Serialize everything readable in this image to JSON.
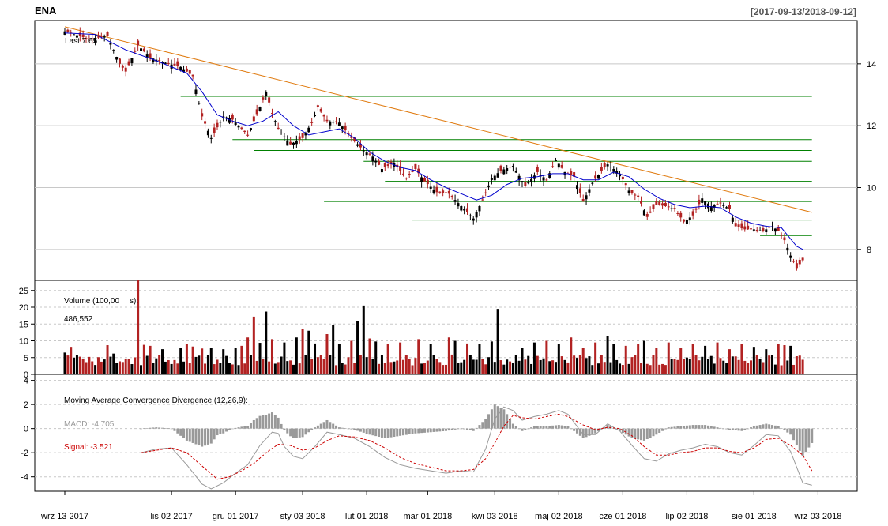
{
  "header": {
    "ticker": "ENA",
    "date_range": "[2017-09-13/2018-09-12]"
  },
  "colors": {
    "up": "#000000",
    "down": "#b22222",
    "sma": "#0000cc",
    "trend": "#e07b10",
    "support": "#008000",
    "macd_hist": "#999999",
    "signal": "#cc0000",
    "macd_line": "#999999"
  },
  "chart_data": [
    {
      "type": "candlestick",
      "panel": "price",
      "last_label": "Last 7.65",
      "x_tick_labels": [
        "wrz 13 2017",
        "lis 02 2017",
        "gru 01 2017",
        "sty 03 2018",
        "lut 01 2018",
        "mar 01 2018",
        "kwi 03 2018",
        "maj 02 2018",
        "cze 01 2018",
        "lip 02 2018",
        "sie 01 2018",
        "wrz 03 2018"
      ],
      "x_tick_index": [
        0,
        35,
        56,
        78,
        99,
        119,
        141,
        162,
        183,
        204,
        226,
        247
      ],
      "n_sessions": 253,
      "y_ticks": [
        8,
        10,
        12,
        14
      ],
      "ylim": [
        7.0,
        15.4
      ],
      "close_path": [
        [
          0,
          15.05
        ],
        [
          8,
          14.8
        ],
        [
          14,
          14.9
        ],
        [
          18,
          14.0
        ],
        [
          20,
          13.75
        ],
        [
          24,
          14.6
        ],
        [
          28,
          14.2
        ],
        [
          34,
          14.0
        ],
        [
          38,
          13.9
        ],
        [
          42,
          13.6
        ],
        [
          45,
          12.3
        ],
        [
          48,
          11.6
        ],
        [
          52,
          12.3
        ],
        [
          55,
          12.2
        ],
        [
          58,
          11.9
        ],
        [
          60,
          11.7
        ],
        [
          64,
          12.6
        ],
        [
          66,
          13.1
        ],
        [
          68,
          12.4
        ],
        [
          70,
          11.9
        ],
        [
          74,
          11.4
        ],
        [
          78,
          11.6
        ],
        [
          81,
          12.1
        ],
        [
          83,
          12.6
        ],
        [
          86,
          12.15
        ],
        [
          90,
          12.1
        ],
        [
          94,
          11.6
        ],
        [
          98,
          11.2
        ],
        [
          101,
          11.0
        ],
        [
          104,
          10.6
        ],
        [
          108,
          10.8
        ],
        [
          112,
          10.3
        ],
        [
          115,
          10.6
        ],
        [
          118,
          10.2
        ],
        [
          122,
          9.85
        ],
        [
          126,
          9.8
        ],
        [
          130,
          9.4
        ],
        [
          134,
          9.0
        ],
        [
          137,
          9.6
        ],
        [
          140,
          10.3
        ],
        [
          143,
          10.55
        ],
        [
          147,
          10.7
        ],
        [
          151,
          10.05
        ],
        [
          155,
          10.5
        ],
        [
          158,
          10.25
        ],
        [
          161,
          10.9
        ],
        [
          164,
          10.5
        ],
        [
          167,
          10.35
        ],
        [
          170,
          9.55
        ],
        [
          173,
          10.15
        ],
        [
          176,
          10.55
        ],
        [
          178,
          10.75
        ],
        [
          182,
          10.45
        ],
        [
          185,
          9.9
        ],
        [
          188,
          9.7
        ],
        [
          191,
          9.05
        ],
        [
          194,
          9.45
        ],
        [
          197,
          9.4
        ],
        [
          200,
          9.3
        ],
        [
          203,
          8.9
        ],
        [
          206,
          9.1
        ],
        [
          209,
          9.65
        ],
        [
          212,
          9.4
        ],
        [
          215,
          9.5
        ],
        [
          218,
          9.3
        ],
        [
          220,
          8.75
        ],
        [
          223,
          8.65
        ],
        [
          226,
          8.65
        ],
        [
          229,
          8.6
        ],
        [
          232,
          8.75
        ],
        [
          234,
          8.6
        ],
        [
          236,
          8.3
        ],
        [
          238,
          7.8
        ],
        [
          240,
          7.4
        ],
        [
          242,
          7.65
        ]
      ],
      "sma_path": [
        [
          0,
          15.0
        ],
        [
          10,
          14.95
        ],
        [
          20,
          14.45
        ],
        [
          30,
          14.1
        ],
        [
          40,
          13.7
        ],
        [
          45,
          13.1
        ],
        [
          50,
          12.35
        ],
        [
          55,
          12.15
        ],
        [
          60,
          12.0
        ],
        [
          65,
          12.15
        ],
        [
          70,
          12.45
        ],
        [
          75,
          12.0
        ],
        [
          80,
          11.7
        ],
        [
          85,
          11.8
        ],
        [
          90,
          11.9
        ],
        [
          95,
          11.6
        ],
        [
          100,
          11.15
        ],
        [
          105,
          10.85
        ],
        [
          110,
          10.65
        ],
        [
          115,
          10.55
        ],
        [
          120,
          10.25
        ],
        [
          125,
          10.0
        ],
        [
          130,
          9.8
        ],
        [
          135,
          9.6
        ],
        [
          140,
          9.75
        ],
        [
          145,
          10.1
        ],
        [
          150,
          10.3
        ],
        [
          155,
          10.35
        ],
        [
          160,
          10.45
        ],
        [
          165,
          10.45
        ],
        [
          170,
          10.25
        ],
        [
          175,
          10.25
        ],
        [
          180,
          10.5
        ],
        [
          185,
          10.35
        ],
        [
          190,
          9.95
        ],
        [
          195,
          9.65
        ],
        [
          200,
          9.45
        ],
        [
          205,
          9.35
        ],
        [
          210,
          9.4
        ],
        [
          215,
          9.35
        ],
        [
          220,
          9.05
        ],
        [
          225,
          8.85
        ],
        [
          230,
          8.75
        ],
        [
          235,
          8.7
        ],
        [
          240,
          8.1
        ],
        [
          242,
          8.0
        ]
      ],
      "trend_line": [
        [
          0,
          15.2
        ],
        [
          245,
          9.2
        ]
      ],
      "support_lines": [
        {
          "y": 12.95,
          "from": 38,
          "to": 245
        },
        {
          "y": 11.55,
          "from": 55,
          "to": 245
        },
        {
          "y": 11.2,
          "from": 62,
          "to": 245
        },
        {
          "y": 10.85,
          "from": 98,
          "to": 245
        },
        {
          "y": 10.2,
          "from": 105,
          "to": 245
        },
        {
          "y": 9.55,
          "from": 85,
          "to": 245
        },
        {
          "y": 8.95,
          "from": 114,
          "to": 245
        },
        {
          "y": 8.45,
          "from": 228,
          "to": 245
        }
      ]
    },
    {
      "type": "bar",
      "panel": "volume",
      "label": "Volume (100,00",
      "label_hidden_tail": "s):",
      "value_label": "486,552",
      "y_ticks": [
        0,
        5,
        10,
        15,
        20,
        25
      ],
      "ylim": [
        0,
        28
      ],
      "baseline": 4.3,
      "spikes": [
        [
          0,
          6.5
        ],
        [
          2,
          8.2
        ],
        [
          14,
          8.7
        ],
        [
          16,
          6.2
        ],
        [
          24,
          28
        ],
        [
          26,
          8.8
        ],
        [
          28,
          8.5
        ],
        [
          32,
          7.5
        ],
        [
          38,
          8.0
        ],
        [
          40,
          9.0
        ],
        [
          42,
          8.3
        ],
        [
          45,
          7.7
        ],
        [
          48,
          7.8
        ],
        [
          52,
          7.5
        ],
        [
          56,
          8.0
        ],
        [
          58,
          8.5
        ],
        [
          60,
          11.0
        ],
        [
          62,
          17.2
        ],
        [
          64,
          9.4
        ],
        [
          66,
          18.7
        ],
        [
          68,
          10.5
        ],
        [
          72,
          9.5
        ],
        [
          76,
          11.0
        ],
        [
          78,
          13.5
        ],
        [
          80,
          13.0
        ],
        [
          82,
          9.2
        ],
        [
          86,
          12.0
        ],
        [
          88,
          14.8
        ],
        [
          90,
          9.0
        ],
        [
          94,
          10.0
        ],
        [
          96,
          16.0
        ],
        [
          98,
          20.5
        ],
        [
          100,
          10.7
        ],
        [
          102,
          9.8
        ],
        [
          106,
          9.0
        ],
        [
          110,
          9.5
        ],
        [
          116,
          10.5
        ],
        [
          120,
          9.0
        ],
        [
          126,
          11.0
        ],
        [
          128,
          10.0
        ],
        [
          132,
          9.2
        ],
        [
          136,
          9.0
        ],
        [
          140,
          9.8
        ],
        [
          142,
          19.5
        ],
        [
          150,
          8.0
        ],
        [
          154,
          9.5
        ],
        [
          158,
          10.0
        ],
        [
          162,
          9.0
        ],
        [
          166,
          11.0
        ],
        [
          170,
          8.0
        ],
        [
          174,
          9.5
        ],
        [
          178,
          11.5
        ],
        [
          180,
          9.0
        ],
        [
          184,
          8.5
        ],
        [
          188,
          9.0
        ],
        [
          190,
          10.0
        ],
        [
          194,
          8.0
        ],
        [
          198,
          9.5
        ],
        [
          202,
          8.0
        ],
        [
          206,
          9.0
        ],
        [
          210,
          8.5
        ],
        [
          214,
          9.5
        ],
        [
          218,
          7.5
        ],
        [
          222,
          9.0
        ],
        [
          226,
          8.2
        ],
        [
          230,
          7.5
        ],
        [
          234,
          9.0
        ],
        [
          236,
          8.7
        ],
        [
          238,
          8.5
        ]
      ]
    },
    {
      "type": "macd",
      "panel": "macd",
      "title": "Moving Average Convergence Divergence (12,26,9):",
      "macd_label": "MACD: -4.705",
      "signal_label": "Signal: -3.521",
      "y_ticks": [
        -4,
        -2,
        0,
        2,
        4
      ],
      "ylim": [
        -5.2,
        4.5
      ],
      "macd_path": [
        [
          25,
          -2.0
        ],
        [
          30,
          -1.7
        ],
        [
          35,
          -1.6
        ],
        [
          40,
          -3.0
        ],
        [
          45,
          -4.6
        ],
        [
          48,
          -5.0
        ],
        [
          52,
          -4.5
        ],
        [
          56,
          -3.7
        ],
        [
          60,
          -3.0
        ],
        [
          64,
          -1.4
        ],
        [
          68,
          -0.3
        ],
        [
          70,
          -0.4
        ],
        [
          72,
          -1.5
        ],
        [
          75,
          -2.3
        ],
        [
          78,
          -2.5
        ],
        [
          82,
          -1.5
        ],
        [
          86,
          -0.3
        ],
        [
          90,
          -0.5
        ],
        [
          95,
          -0.8
        ],
        [
          100,
          -1.5
        ],
        [
          105,
          -2.4
        ],
        [
          110,
          -3.0
        ],
        [
          115,
          -3.3
        ],
        [
          120,
          -3.5
        ],
        [
          125,
          -3.7
        ],
        [
          130,
          -3.5
        ],
        [
          134,
          -3.6
        ],
        [
          138,
          -1.7
        ],
        [
          141,
          0.8
        ],
        [
          144,
          1.8
        ],
        [
          147,
          1.5
        ],
        [
          150,
          0.7
        ],
        [
          154,
          1.0
        ],
        [
          158,
          1.2
        ],
        [
          162,
          1.5
        ],
        [
          165,
          1.2
        ],
        [
          170,
          -0.5
        ],
        [
          174,
          -0.5
        ],
        [
          178,
          0.4
        ],
        [
          182,
          -0.2
        ],
        [
          186,
          -1.4
        ],
        [
          190,
          -2.5
        ],
        [
          194,
          -2.7
        ],
        [
          198,
          -2.1
        ],
        [
          202,
          -1.8
        ],
        [
          206,
          -1.6
        ],
        [
          210,
          -1.3
        ],
        [
          214,
          -1.5
        ],
        [
          218,
          -2.0
        ],
        [
          222,
          -2.2
        ],
        [
          226,
          -1.4
        ],
        [
          230,
          -0.5
        ],
        [
          234,
          -0.6
        ],
        [
          238,
          -1.9
        ],
        [
          242,
          -4.5
        ],
        [
          245,
          -4.7
        ]
      ],
      "signal_path": [
        [
          25,
          -2.0
        ],
        [
          30,
          -1.8
        ],
        [
          35,
          -1.6
        ],
        [
          40,
          -2.0
        ],
        [
          45,
          -3.1
        ],
        [
          50,
          -4.2
        ],
        [
          54,
          -4.0
        ],
        [
          58,
          -3.5
        ],
        [
          62,
          -2.9
        ],
        [
          66,
          -2.0
        ],
        [
          70,
          -1.3
        ],
        [
          74,
          -1.4
        ],
        [
          78,
          -1.8
        ],
        [
          82,
          -1.6
        ],
        [
          86,
          -1.0
        ],
        [
          90,
          -0.6
        ],
        [
          95,
          -0.7
        ],
        [
          100,
          -1.0
        ],
        [
          105,
          -1.6
        ],
        [
          110,
          -2.4
        ],
        [
          115,
          -2.9
        ],
        [
          120,
          -3.2
        ],
        [
          125,
          -3.5
        ],
        [
          130,
          -3.5
        ],
        [
          134,
          -3.4
        ],
        [
          138,
          -2.5
        ],
        [
          141,
          -1.2
        ],
        [
          144,
          0.2
        ],
        [
          147,
          1.1
        ],
        [
          150,
          0.9
        ],
        [
          154,
          0.8
        ],
        [
          158,
          1.0
        ],
        [
          162,
          1.2
        ],
        [
          165,
          1.0
        ],
        [
          170,
          0.3
        ],
        [
          174,
          -0.1
        ],
        [
          178,
          0.1
        ],
        [
          182,
          0.0
        ],
        [
          186,
          -0.6
        ],
        [
          190,
          -1.5
        ],
        [
          194,
          -2.2
        ],
        [
          198,
          -2.2
        ],
        [
          202,
          -2.0
        ],
        [
          206,
          -1.9
        ],
        [
          210,
          -1.6
        ],
        [
          214,
          -1.6
        ],
        [
          218,
          -1.9
        ],
        [
          222,
          -2.0
        ],
        [
          226,
          -1.6
        ],
        [
          230,
          -0.9
        ],
        [
          234,
          -0.8
        ],
        [
          238,
          -1.4
        ],
        [
          242,
          -2.2
        ],
        [
          245,
          -3.5
        ]
      ]
    }
  ]
}
